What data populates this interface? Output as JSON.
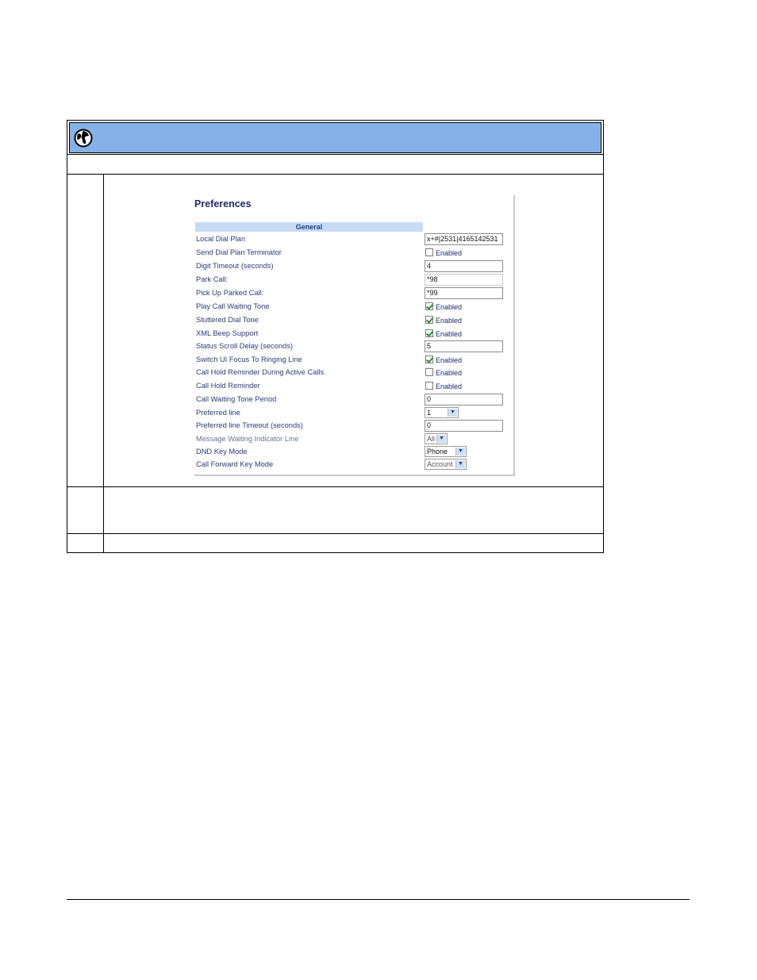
{
  "panel": {
    "title": "Preferences",
    "section": "General",
    "fields": {
      "local_dial_plan": {
        "label": "Local Dial Plan",
        "value": "x+#|2531|4165142531"
      },
      "send_dial_plan_terminator": {
        "label": "Send Dial Plan Terminator",
        "checkbox_label": "Enabled",
        "checked": false
      },
      "digit_timeout": {
        "label": "Digit Timeout (seconds)",
        "value": "4"
      },
      "park_call": {
        "label": "Park Call:",
        "value": "*98"
      },
      "pick_up_parked_call": {
        "label": "Pick Up Parked Call:",
        "value": "*99"
      },
      "play_call_waiting_tone": {
        "label": "Play Call Waiting Tone",
        "checkbox_label": "Enabled",
        "checked": true
      },
      "stuttered_dial_tone": {
        "label": "Stuttered Dial Tone",
        "checkbox_label": "Enabled",
        "checked": true
      },
      "xml_beep_support": {
        "label": "XML Beep Support",
        "checkbox_label": "Enabled",
        "checked": true
      },
      "status_scroll_delay": {
        "label": "Status Scroll Delay (seconds)",
        "value": "5"
      },
      "switch_ui_focus": {
        "label": "Switch UI Focus To Ringing Line",
        "checkbox_label": "Enabled",
        "checked": true
      },
      "call_hold_reminder_active": {
        "label": "Call Hold Reminder During Active Calls",
        "checkbox_label": "Enabled",
        "checked": false
      },
      "call_hold_reminder": {
        "label": "Call Hold Reminder",
        "checkbox_label": "Enabled",
        "checked": false
      },
      "call_waiting_tone_period": {
        "label": "Call Waiting Tone Period",
        "value": "0"
      },
      "preferred_line": {
        "label": "Preferred line",
        "value": "1"
      },
      "preferred_line_timeout": {
        "label": "Preferred line Timeout (seconds)",
        "value": "0"
      },
      "mwi_line": {
        "label": "Message Waiting Indicator Line",
        "value": "All"
      },
      "dnd_key_mode": {
        "label": "DND Key Mode",
        "value": "Phone"
      },
      "call_forward_key_mode": {
        "label": "Call Forward Key Mode",
        "value": "Account"
      }
    }
  },
  "colors": {
    "header_bar": "#84b2e8",
    "section_bar": "#c7dcf3",
    "label_text": "#2a3b78",
    "check_mark": "#2c8a2c"
  },
  "icons": {
    "header": "globe-icon",
    "dropdown": "chevron-down-icon"
  }
}
